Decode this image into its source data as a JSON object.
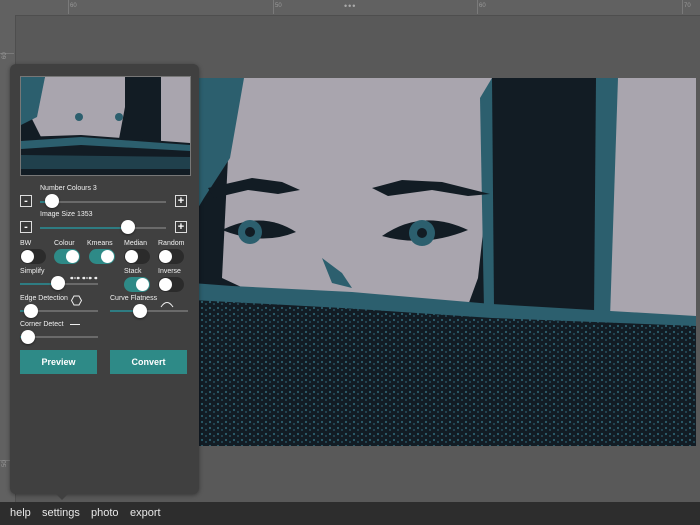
{
  "ruler": {
    "top_numbers": [
      "60",
      "50",
      "60",
      "70"
    ],
    "left_numbers": [
      "60",
      "50"
    ]
  },
  "panel": {
    "number_colours": {
      "label": "Number Colours 3",
      "value": 3
    },
    "image_size": {
      "label": "Image Size 1353",
      "value": 1353
    },
    "minus": "-",
    "plus": "+",
    "toggles": {
      "bw": {
        "label": "BW",
        "on": false
      },
      "colour": {
        "label": "Colour",
        "on": true
      },
      "kmeans": {
        "label": "Kmeans",
        "on": true
      },
      "median": {
        "label": "Median",
        "on": false
      },
      "random": {
        "label": "Random",
        "on": false
      },
      "stack": {
        "label": "Stack",
        "on": true
      },
      "inverse": {
        "label": "Inverse",
        "on": false
      }
    },
    "simplify": {
      "label": "Simplify",
      "icon": "dotted-line-icon"
    },
    "edge_detection": {
      "label": "Edge Detection",
      "icon": "hexagon-icon"
    },
    "curve_flatness": {
      "label": "Curve Flatness",
      "icon": "arc-icon"
    },
    "corner_detect": {
      "label": "Corner Detect",
      "icon": "line-icon"
    },
    "preview_label": "Preview",
    "convert_label": "Convert"
  },
  "bottom_menu": [
    "help",
    "settings",
    "photo",
    "export"
  ],
  "colors": {
    "accent": "#2e8a87",
    "dark": "#121c24",
    "light": "#a9a5ae",
    "teal": "#2c5f6e"
  }
}
